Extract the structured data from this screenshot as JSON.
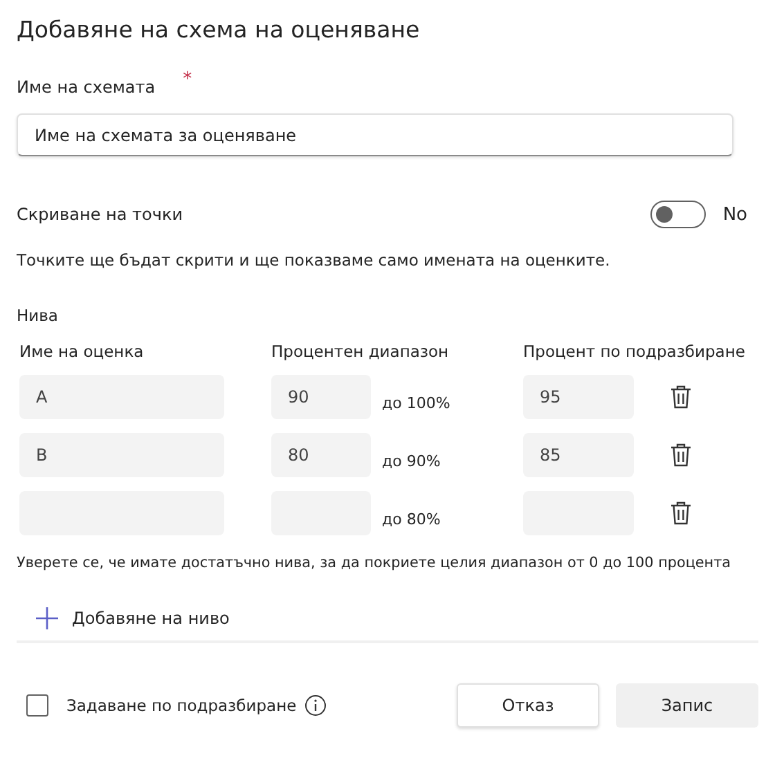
{
  "title": "Добавяне на схема на оценяване",
  "scheme_name": {
    "label": "Име на схемата",
    "required_mark": "*",
    "value": "Име на схемата за оценяване"
  },
  "hide_points": {
    "label": "Скриване на точки",
    "on": false,
    "state_text": "No",
    "description": "Точките ще бъдат скрити и ще показваме само имената на оценките."
  },
  "levels": {
    "label": "Нива",
    "columns": [
      "Име на оценка",
      "Процентен диапазон",
      "Процент по подразбиране"
    ],
    "rows": [
      {
        "grade": "A",
        "from": "90",
        "to": "до 100%",
        "default": "95"
      },
      {
        "grade": "B",
        "from": "80",
        "to": "до 90%",
        "default": "85"
      },
      {
        "to": "до 80%"
      }
    ],
    "hint": "Уверете се, че имате достатъчно нива, за да покриете целия диапазон от 0 до 100 процента",
    "add_label": "Добавяне на ниво"
  },
  "footer": {
    "default_checkbox": {
      "label": "Задаване по подразбиране",
      "checked": false
    },
    "buttons": [
      {
        "label": "Отказ",
        "kind": "secondary"
      },
      {
        "label": "Запис",
        "kind": "primary"
      }
    ]
  }
}
